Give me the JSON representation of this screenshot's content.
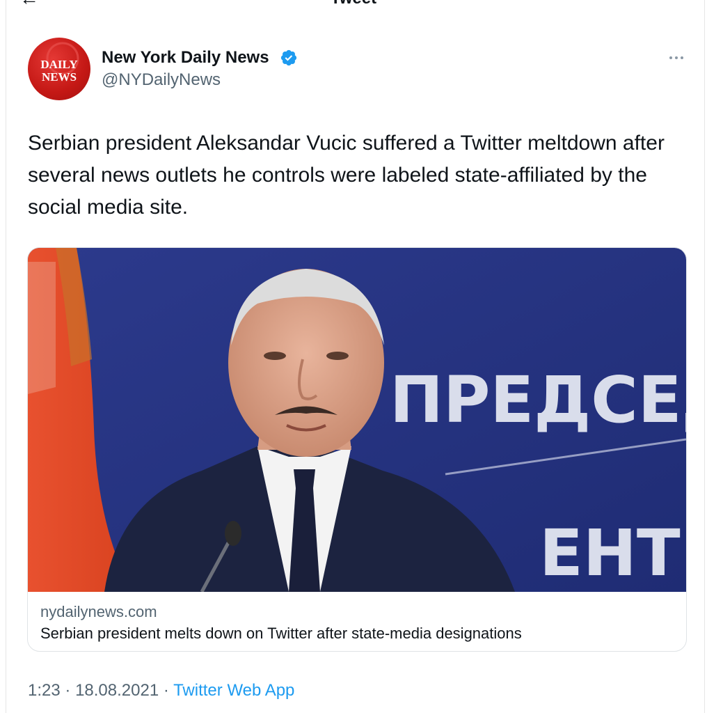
{
  "header": {
    "title": "Tweet",
    "back_icon": "back-arrow-icon"
  },
  "tweet": {
    "author": {
      "display_name": "New York Daily News",
      "handle": "@NYDailyNews",
      "verified": true,
      "avatar_text_line1": "DAILY",
      "avatar_text_line2": "NEWS"
    },
    "text": "Serbian president Aleksandar Vucic suffered a Twitter meltdown after several news outlets he controls were labeled state-affiliated by the social media site.",
    "card": {
      "image_overlay_text_1": "ПРЕДСЕД",
      "image_overlay_text_2": "ЕНТ",
      "domain": "nydailynews.com",
      "title": "Serbian president melts down on Twitter after state-media designations"
    },
    "meta": {
      "time": "1:23",
      "separator": "·",
      "date": "18.08.2021",
      "source": "Twitter Web App"
    }
  },
  "colors": {
    "accent": "#1d9bf0",
    "secondary_text": "#536471",
    "avatar_red": "#c41815"
  }
}
